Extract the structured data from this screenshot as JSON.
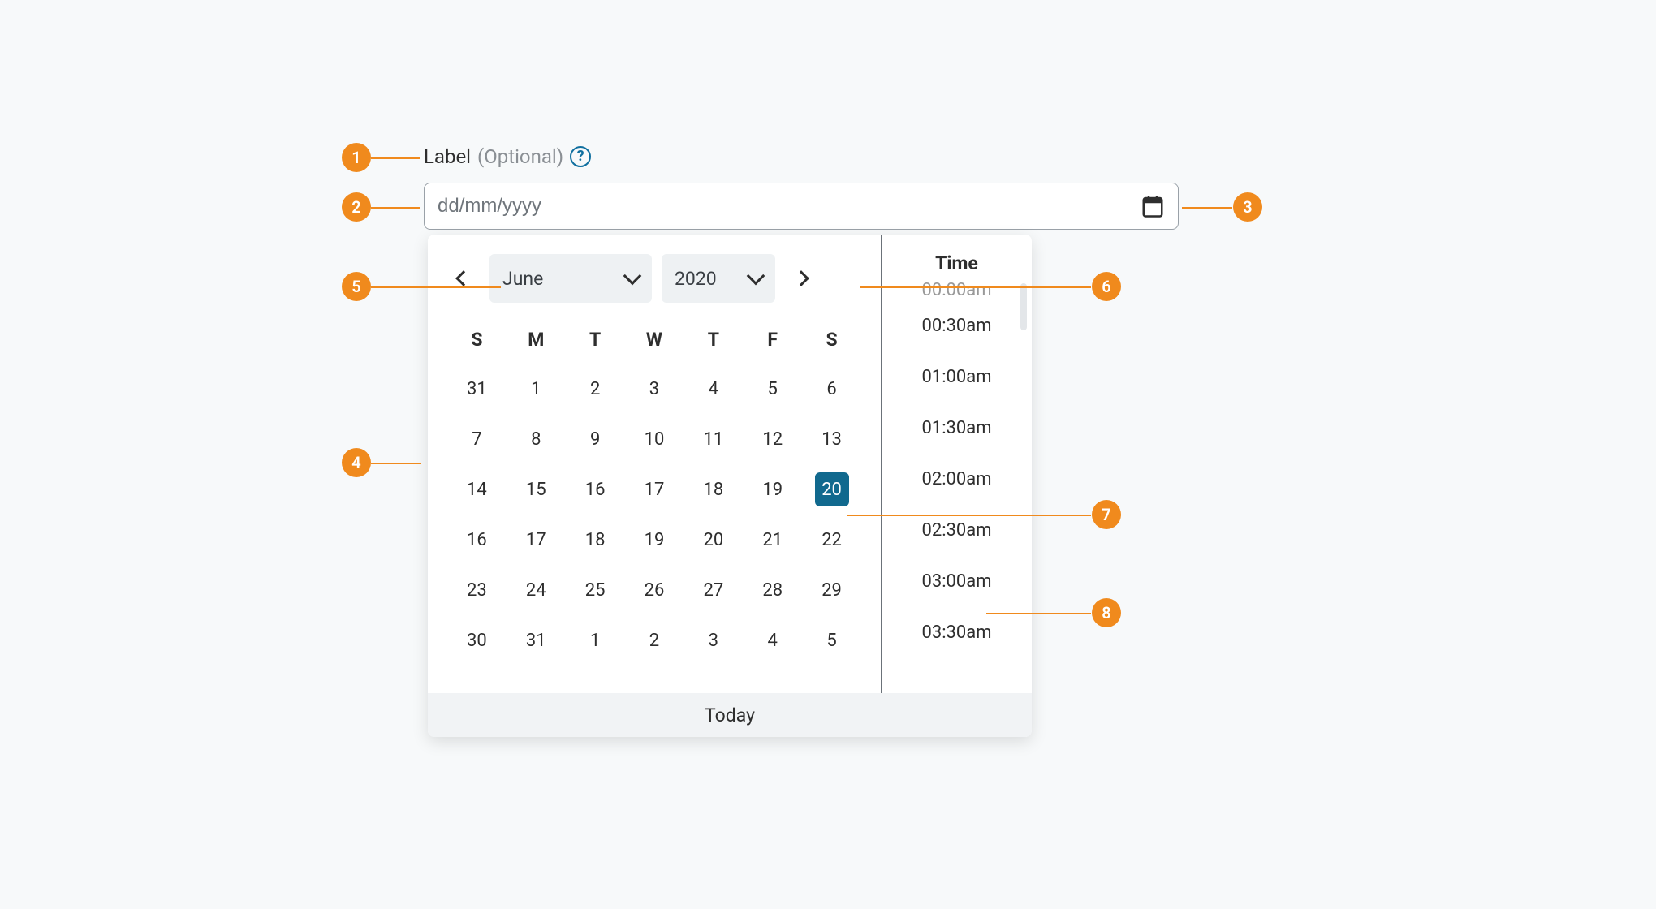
{
  "label": {
    "text": "Label",
    "optional": "(Optional)"
  },
  "input": {
    "placeholder": "dd/mm/yyyy"
  },
  "calendar": {
    "month": "June",
    "year": "2020",
    "dayHeaders": [
      "S",
      "M",
      "T",
      "W",
      "T",
      "F",
      "S"
    ],
    "weeks": [
      [
        "31",
        "1",
        "2",
        "3",
        "4",
        "5",
        "6"
      ],
      [
        "7",
        "8",
        "9",
        "10",
        "11",
        "12",
        "13"
      ],
      [
        "14",
        "15",
        "16",
        "17",
        "18",
        "19",
        "20"
      ],
      [
        "16",
        "17",
        "18",
        "19",
        "20",
        "21",
        "22"
      ],
      [
        "23",
        "24",
        "25",
        "26",
        "27",
        "28",
        "29"
      ],
      [
        "30",
        "31",
        "1",
        "2",
        "3",
        "4",
        "5"
      ]
    ],
    "selectedDay": "20",
    "selectedRow": 2,
    "selectedCol": 6
  },
  "time": {
    "header": "Time",
    "clippedTop": "00:00am",
    "items": [
      "00:30am",
      "01:00am",
      "01:30am",
      "02:00am",
      "02:30am",
      "03:00am",
      "03:30am"
    ]
  },
  "footer": {
    "today": "Today"
  },
  "annotations": {
    "1": "1",
    "2": "2",
    "3": "3",
    "4": "4",
    "5": "5",
    "6": "6",
    "7": "7",
    "8": "8"
  }
}
